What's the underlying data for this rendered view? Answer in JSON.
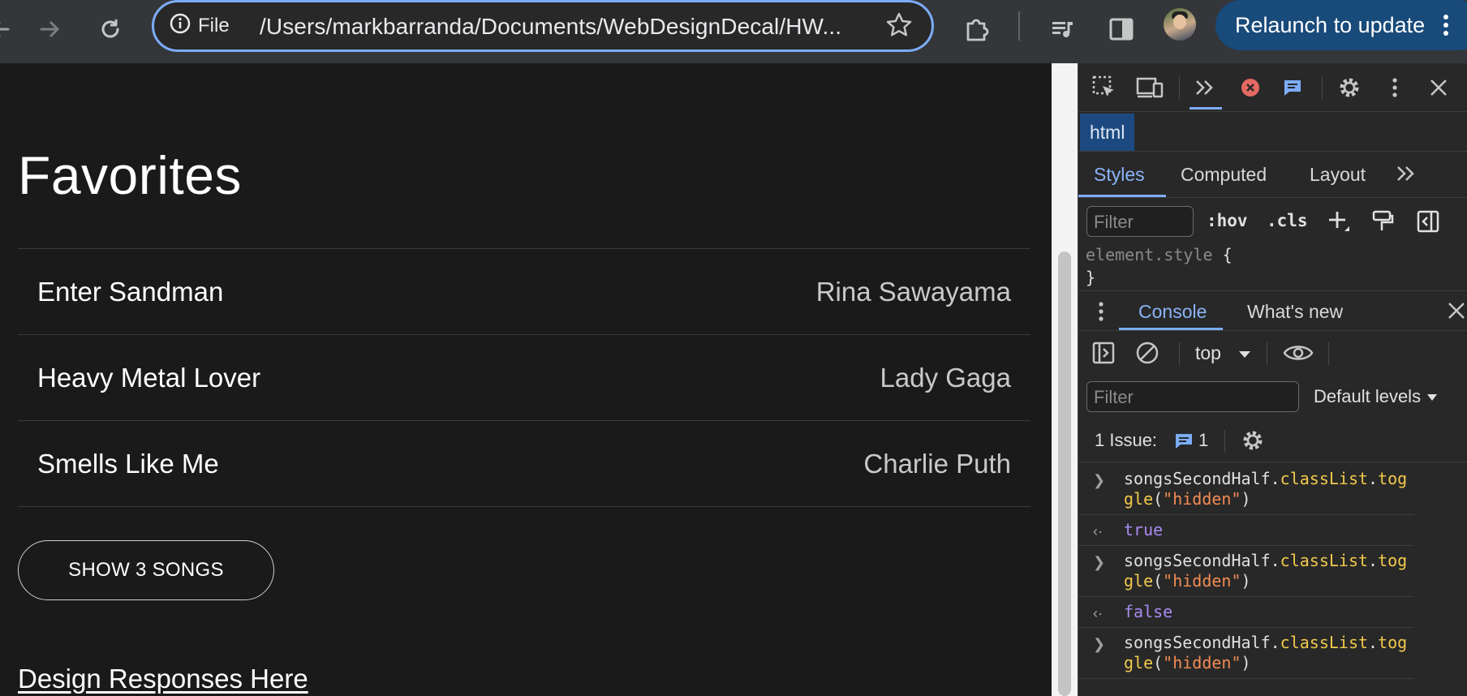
{
  "browser": {
    "omnibox": {
      "scheme_label": "File",
      "url": "/Users/markbarranda/Documents/WebDesignDecal/HW..."
    },
    "relaunch_label": "Relaunch to update"
  },
  "page": {
    "title": "Favorites",
    "songs": [
      {
        "name": "Enter Sandman",
        "artist": "Rina Sawayama"
      },
      {
        "name": "Heavy Metal Lover",
        "artist": "Lady Gaga"
      },
      {
        "name": "Smells Like Me",
        "artist": "Charlie Puth"
      }
    ],
    "show_button_label": "SHOW 3 SONGS",
    "design_link_label": "Design Responses Here"
  },
  "devtools": {
    "breadcrumb": "html",
    "styles_tabs": [
      "Styles",
      "Computed",
      "Layout"
    ],
    "styles_filter_placeholder": "Filter",
    "hov_label": ":hov",
    "cls_label": ".cls",
    "element_style_selector": "element.style",
    "open_brace": "{",
    "close_brace": "}",
    "console_tabs": [
      "Console",
      "What's new"
    ],
    "context_label": "top",
    "console_filter_placeholder": "Filter",
    "levels_label": "Default levels",
    "issues_label": "1 Issue:",
    "issues_count": "1",
    "log": [
      {
        "kind": "input",
        "object": "songsSecondHalf",
        "prop": "classList",
        "method": "toggle",
        "arg": "\"hidden\""
      },
      {
        "kind": "output",
        "value": "true"
      },
      {
        "kind": "input",
        "object": "songsSecondHalf",
        "prop": "classList",
        "method": "toggle",
        "arg": "\"hidden\""
      },
      {
        "kind": "output",
        "value": "false"
      },
      {
        "kind": "input",
        "object": "songsSecondHalf",
        "prop": "classList",
        "method": "toggle",
        "arg": "\"hidden\""
      }
    ]
  },
  "colors": {
    "page_bg": "#1a1a1a",
    "devtools_accent": "#8ab4f8",
    "relaunch_bg": "#184a7a",
    "string_token": "#f28b54",
    "property_token": "#f2c94c",
    "boolean_token": "#a98bf0"
  },
  "icons": [
    "back-arrow-icon",
    "forward-arrow-icon",
    "reload-icon",
    "info-icon",
    "star-icon",
    "extensions-icon",
    "media-controls-icon",
    "side-panel-icon",
    "more-vert-icon"
  ]
}
